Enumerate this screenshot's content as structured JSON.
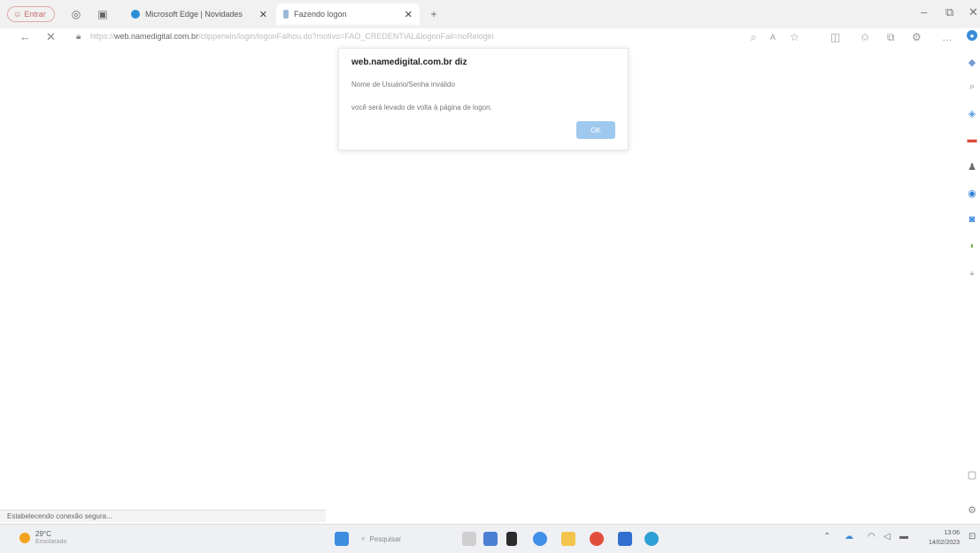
{
  "tabs": {
    "sair_label": "Entrar",
    "tab1_title": "Microsoft Edge | Novidades",
    "tab2_title": "Fazendo logon"
  },
  "address": {
    "url_prefix": "https://",
    "url_domain": "web.namedigital.com.br",
    "url_path": "/clipperwin/login/logonFalhou.do?motivo=FAO_CREDENTIAL&logonFail=noRelogin"
  },
  "dialog": {
    "title": "web.namedigital.com.br diz",
    "message1": "Nome de Usuário/Senha inválido",
    "message2": "você será levado de volta à página de logon.",
    "ok_label": "OK"
  },
  "status_bar": {
    "text": "Estabelecendo conexão segura..."
  },
  "taskbar": {
    "temperature": "29°C",
    "weather_desc": "Ensolarado",
    "search_placeholder": "Pesquisar",
    "time": "13:06",
    "date": "14/02/2023"
  },
  "colors": {
    "accent": "#9ec8ee",
    "sair_border": "#e3a9a9",
    "taskbar_bg": "#eef0f3"
  }
}
